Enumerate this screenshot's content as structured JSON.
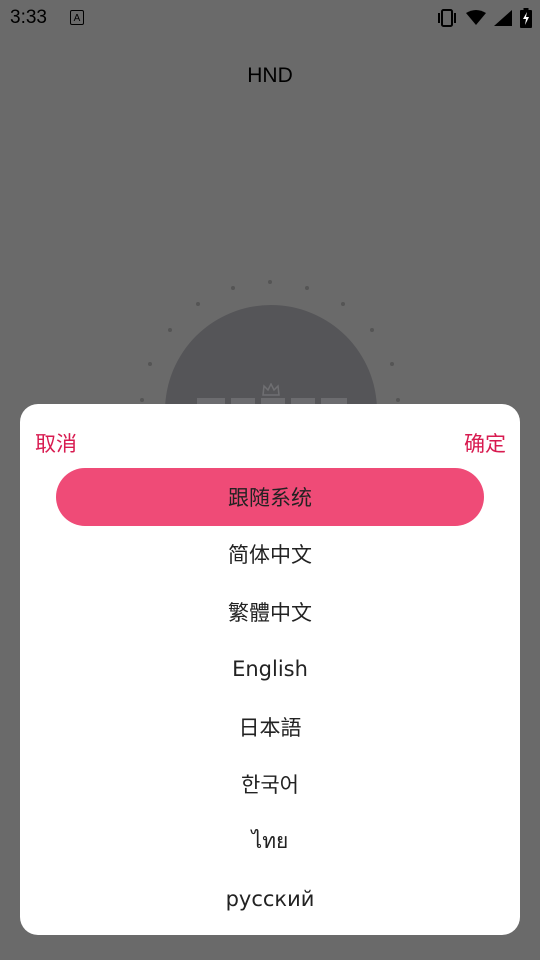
{
  "status_bar": {
    "time": "3:33",
    "notification_icon": "a-icon",
    "icons": [
      "vibrate-icon",
      "wifi-icon",
      "signal-icon",
      "battery-charging-icon"
    ]
  },
  "page": {
    "title": "HND"
  },
  "language_sheet": {
    "cancel_label": "取消",
    "confirm_label": "确定",
    "selected_index": 0,
    "options": [
      {
        "label": "跟随系统"
      },
      {
        "label": "简体中文"
      },
      {
        "label": "繁體中文"
      },
      {
        "label": "English"
      },
      {
        "label": "日本語"
      },
      {
        "label": "한국어"
      },
      {
        "label": "ไทย"
      },
      {
        "label": "русский"
      }
    ]
  },
  "colors": {
    "overlay_background": "#6a6a6a",
    "accent": "#d81b50",
    "selected_background": "#ef4b77",
    "sheet_background": "#ffffff"
  }
}
